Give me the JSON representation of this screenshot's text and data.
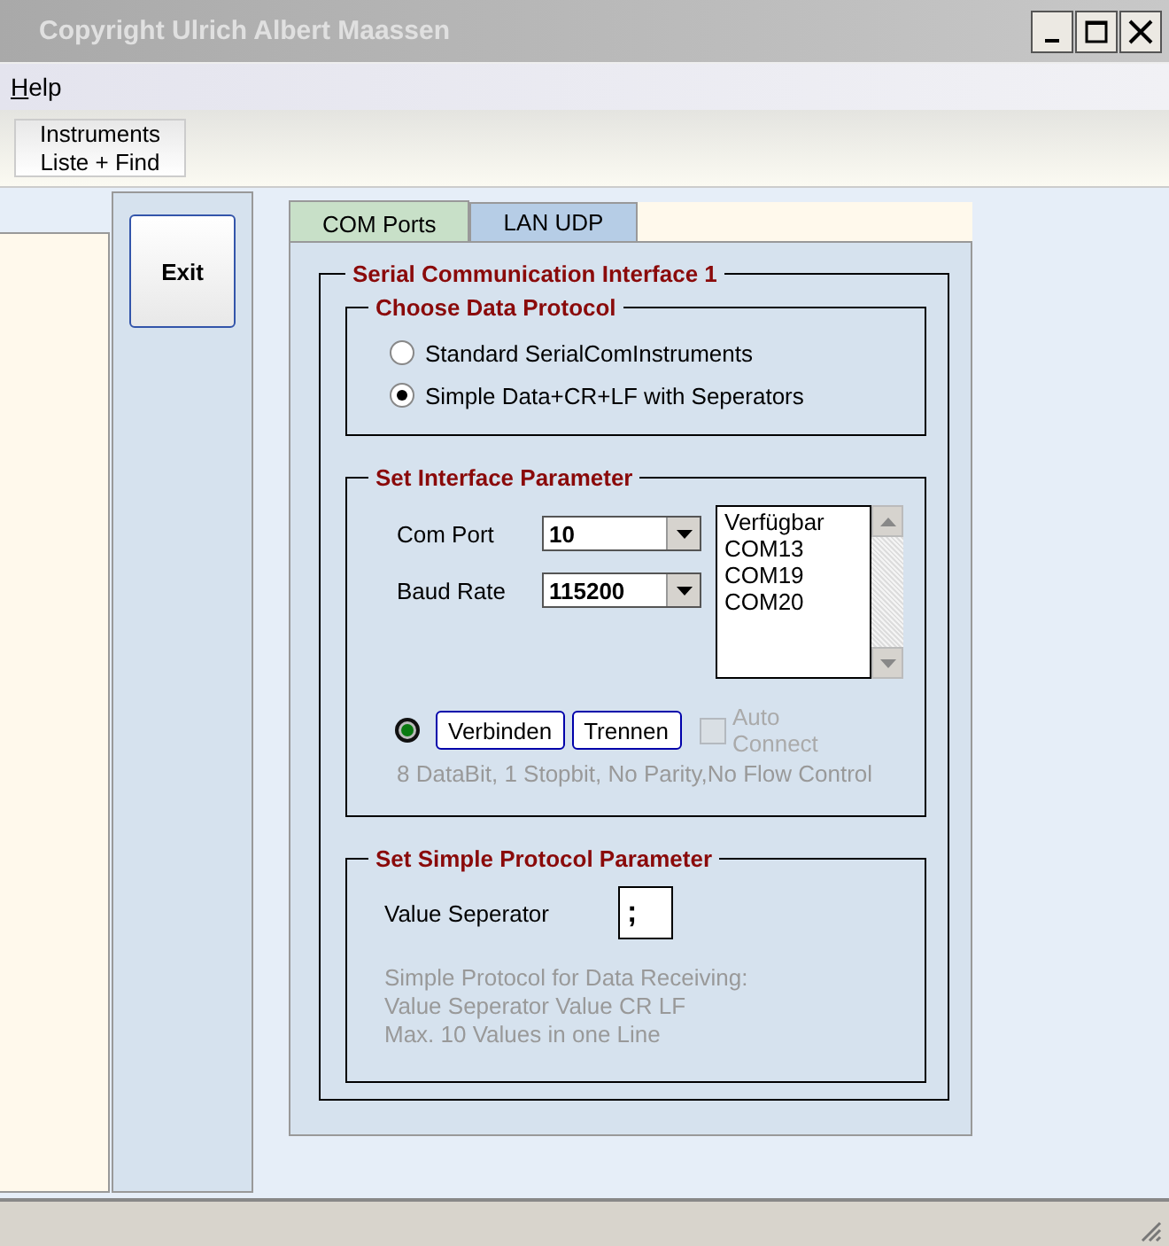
{
  "window": {
    "title": "Copyright Ulrich Albert Maassen"
  },
  "menu": [
    {
      "label": "Help"
    }
  ],
  "toolbar": {
    "button_lines": [
      "Instruments",
      "Liste + Find"
    ]
  },
  "side": {
    "exit_button": "Exit"
  },
  "tabs": [
    {
      "label": "COM Ports",
      "selected": true
    },
    {
      "label": "LAN UDP",
      "selected": false
    }
  ],
  "interface_group": {
    "title": "Serial Communication Interface 1",
    "protocol": {
      "title": "Choose Data Protocol",
      "options": [
        {
          "label": "Standard SerialComInstruments",
          "selected": false
        },
        {
          "label": "Simple Data+CR+LF with Seperators",
          "selected": true
        }
      ]
    },
    "parameters": {
      "title": "Set Interface Parameter",
      "com_port": {
        "label": "Com Port",
        "value": "10"
      },
      "baud_rate": {
        "label": "Baud Rate",
        "value": "115200"
      },
      "ports_list": [
        "Verfügbar",
        "COM13",
        "COM19",
        "COM20"
      ],
      "connect_button": "Verbinden",
      "disconnect_button": "Trennen",
      "auto_connect": {
        "label": "Auto Connect",
        "checked": false,
        "disabled": true
      },
      "info": "8 DataBit, 1 Stopbit, No Parity,No Flow Control"
    },
    "simple": {
      "title": "Set Simple Protocol Parameter",
      "separator": {
        "label": "Value Seperator",
        "value": ";"
      },
      "info_lines": [
        "Simple Protocol for Data Receiving:",
        "Value Seperator Value CR LF",
        "Max. 10 Values in one Line"
      ]
    }
  }
}
